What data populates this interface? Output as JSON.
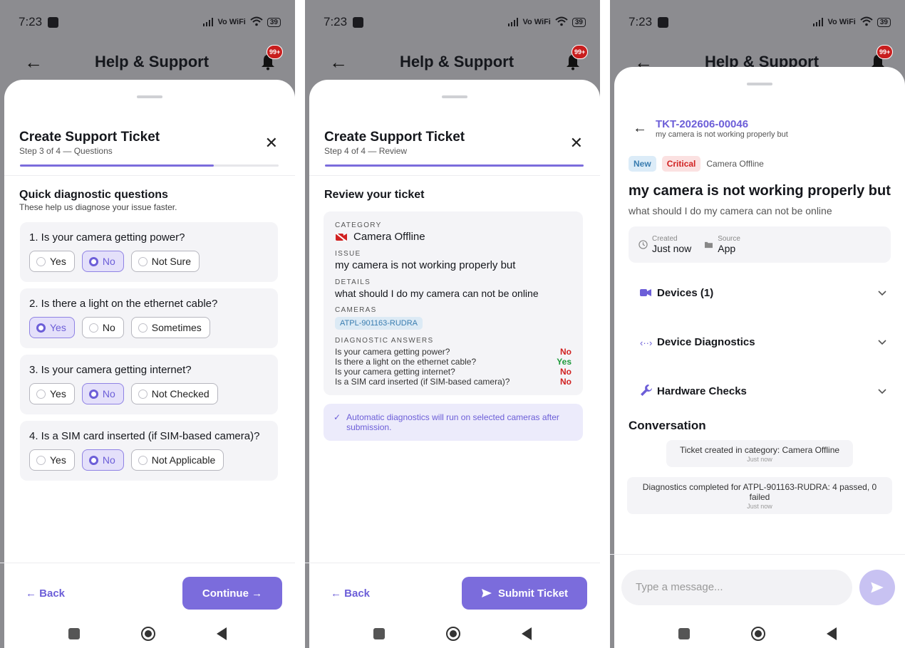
{
  "status": {
    "time": "7:23",
    "net": "Vo WiFi",
    "battery": "39"
  },
  "appbar": {
    "title": "Help & Support",
    "badge": "99+"
  },
  "screen1": {
    "title": "Create Support Ticket",
    "step": "Step 3 of 4 — Questions",
    "progress": 0.75,
    "section_title": "Quick diagnostic questions",
    "section_sub": "These help us diagnose your issue faster.",
    "questions": [
      {
        "text": "1. Is your camera getting power?",
        "options": [
          "Yes",
          "No",
          "Not Sure"
        ],
        "selected": 1
      },
      {
        "text": "2. Is there a light on the ethernet cable?",
        "options": [
          "Yes",
          "No",
          "Sometimes"
        ],
        "selected": 0
      },
      {
        "text": "3. Is your camera getting internet?",
        "options": [
          "Yes",
          "No",
          "Not Checked"
        ],
        "selected": 1
      },
      {
        "text": "4. Is a SIM card inserted (if SIM-based camera)?",
        "options": [
          "Yes",
          "No",
          "Not Applicable"
        ],
        "selected": 1
      }
    ],
    "back_label": "← Back",
    "continue_label": "Continue →"
  },
  "screen2": {
    "title": "Create Support Ticket",
    "step": "Step 4 of 4 — Review",
    "progress": 1.0,
    "section_title": "Review your ticket",
    "category_label": "CATEGORY",
    "category_value": "Camera Offline",
    "issue_label": "ISSUE",
    "issue_value": "my camera is not working properly but",
    "details_label": "DETAILS",
    "details_value": "what should I do my camera can not be online",
    "cameras_label": "CAMERAS",
    "camera_chip": "ATPL-901163-RUDRA",
    "diag_label": "DIAGNOSTIC ANSWERS",
    "answers": [
      {
        "q": "Is your camera getting power?",
        "a": "No"
      },
      {
        "q": "Is there a light on the ethernet cable?",
        "a": "Yes"
      },
      {
        "q": "Is your camera getting internet?",
        "a": "No"
      },
      {
        "q": "Is a SIM card inserted (if SIM-based camera)?",
        "a": "No"
      }
    ],
    "info": "Automatic diagnostics will run on selected cameras after submission.",
    "back_label": "← Back",
    "submit_label": "Submit Ticket"
  },
  "screen3": {
    "ticket_id": "TKT-202606-00046",
    "ticket_sub": "my camera is not working properly but",
    "tag_new": "New",
    "tag_critical": "Critical",
    "tag_category": "Camera Offline",
    "title": "my camera is not working properly but",
    "description": "what should I do my camera can not be online",
    "created_label": "Created",
    "created_value": "Just now",
    "source_label": "Source",
    "source_value": "App",
    "sections": [
      {
        "icon": "video-icon",
        "label": "Devices (1)"
      },
      {
        "icon": "code-icon",
        "label": "Device Diagnostics"
      },
      {
        "icon": "wrench-icon",
        "label": "Hardware Checks"
      }
    ],
    "conversation_title": "Conversation",
    "messages": [
      {
        "text": "Ticket created in category: Camera Offline",
        "time": "Just now"
      },
      {
        "text": "Diagnostics completed for ATPL-901163-RUDRA: 4 passed, 0 failed",
        "time": "Just now"
      }
    ],
    "input_placeholder": "Type a message..."
  },
  "colors": {
    "accent": "#7b6cdc",
    "no": "#d12222",
    "yes": "#1e9a3c"
  }
}
